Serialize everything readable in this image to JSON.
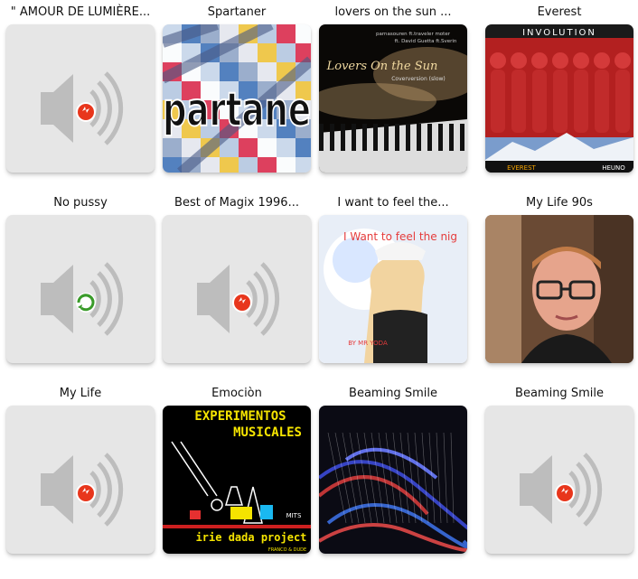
{
  "tiles": [
    {
      "title": "\" AMOUR DE LUMIÈRE...",
      "art": "placeholder",
      "badge": "broken"
    },
    {
      "title": "Spartaner",
      "art": "spartaner",
      "overlay_text": "partane"
    },
    {
      "title": "lovers on the sun ...",
      "art": "lovers",
      "overlay_text": "Lovers On the Sun",
      "small_text_1": "parnasouren ft.traveler moter",
      "small_text_2": "ft. David Guetta ft.Sverin",
      "small_text_3": "Coverversion (slow)"
    },
    {
      "title": "Everest",
      "art": "everest",
      "overlay_text": "INVOLUTION",
      "small_text_1": "EVEREST",
      "small_text_2": "HEUNO"
    },
    {
      "title": "No pussy",
      "art": "placeholder",
      "badge": "loading"
    },
    {
      "title": "Best of Magix 1996...",
      "art": "placeholder",
      "badge": "broken"
    },
    {
      "title": "I want to feel the...",
      "art": "feel",
      "overlay_text": "I Want to feel the nig",
      "small_text_1": "BY MR YODA"
    },
    {
      "title": "My Life 90s",
      "art": "portrait"
    },
    {
      "title": "My Life",
      "art": "placeholder",
      "badge": "broken"
    },
    {
      "title": "Emociòn",
      "art": "experimentos",
      "overlay_text": "EXPERIMENTOS",
      "small_text_1": "MUSICALES",
      "small_text_2": "irie dada project",
      "small_text_3": "FRANCO & DUDE",
      "small_text_4": "MITS"
    },
    {
      "title": "Beaming Smile",
      "art": "fountain"
    },
    {
      "title": "Beaming Smile",
      "art": "placeholder",
      "badge": "broken"
    }
  ],
  "colors": {
    "badge_broken": "#e8361c",
    "badge_loading": "#3a9b2a",
    "placeholder_bg": "#e6e6e6",
    "speaker": "#bdbdbd"
  }
}
